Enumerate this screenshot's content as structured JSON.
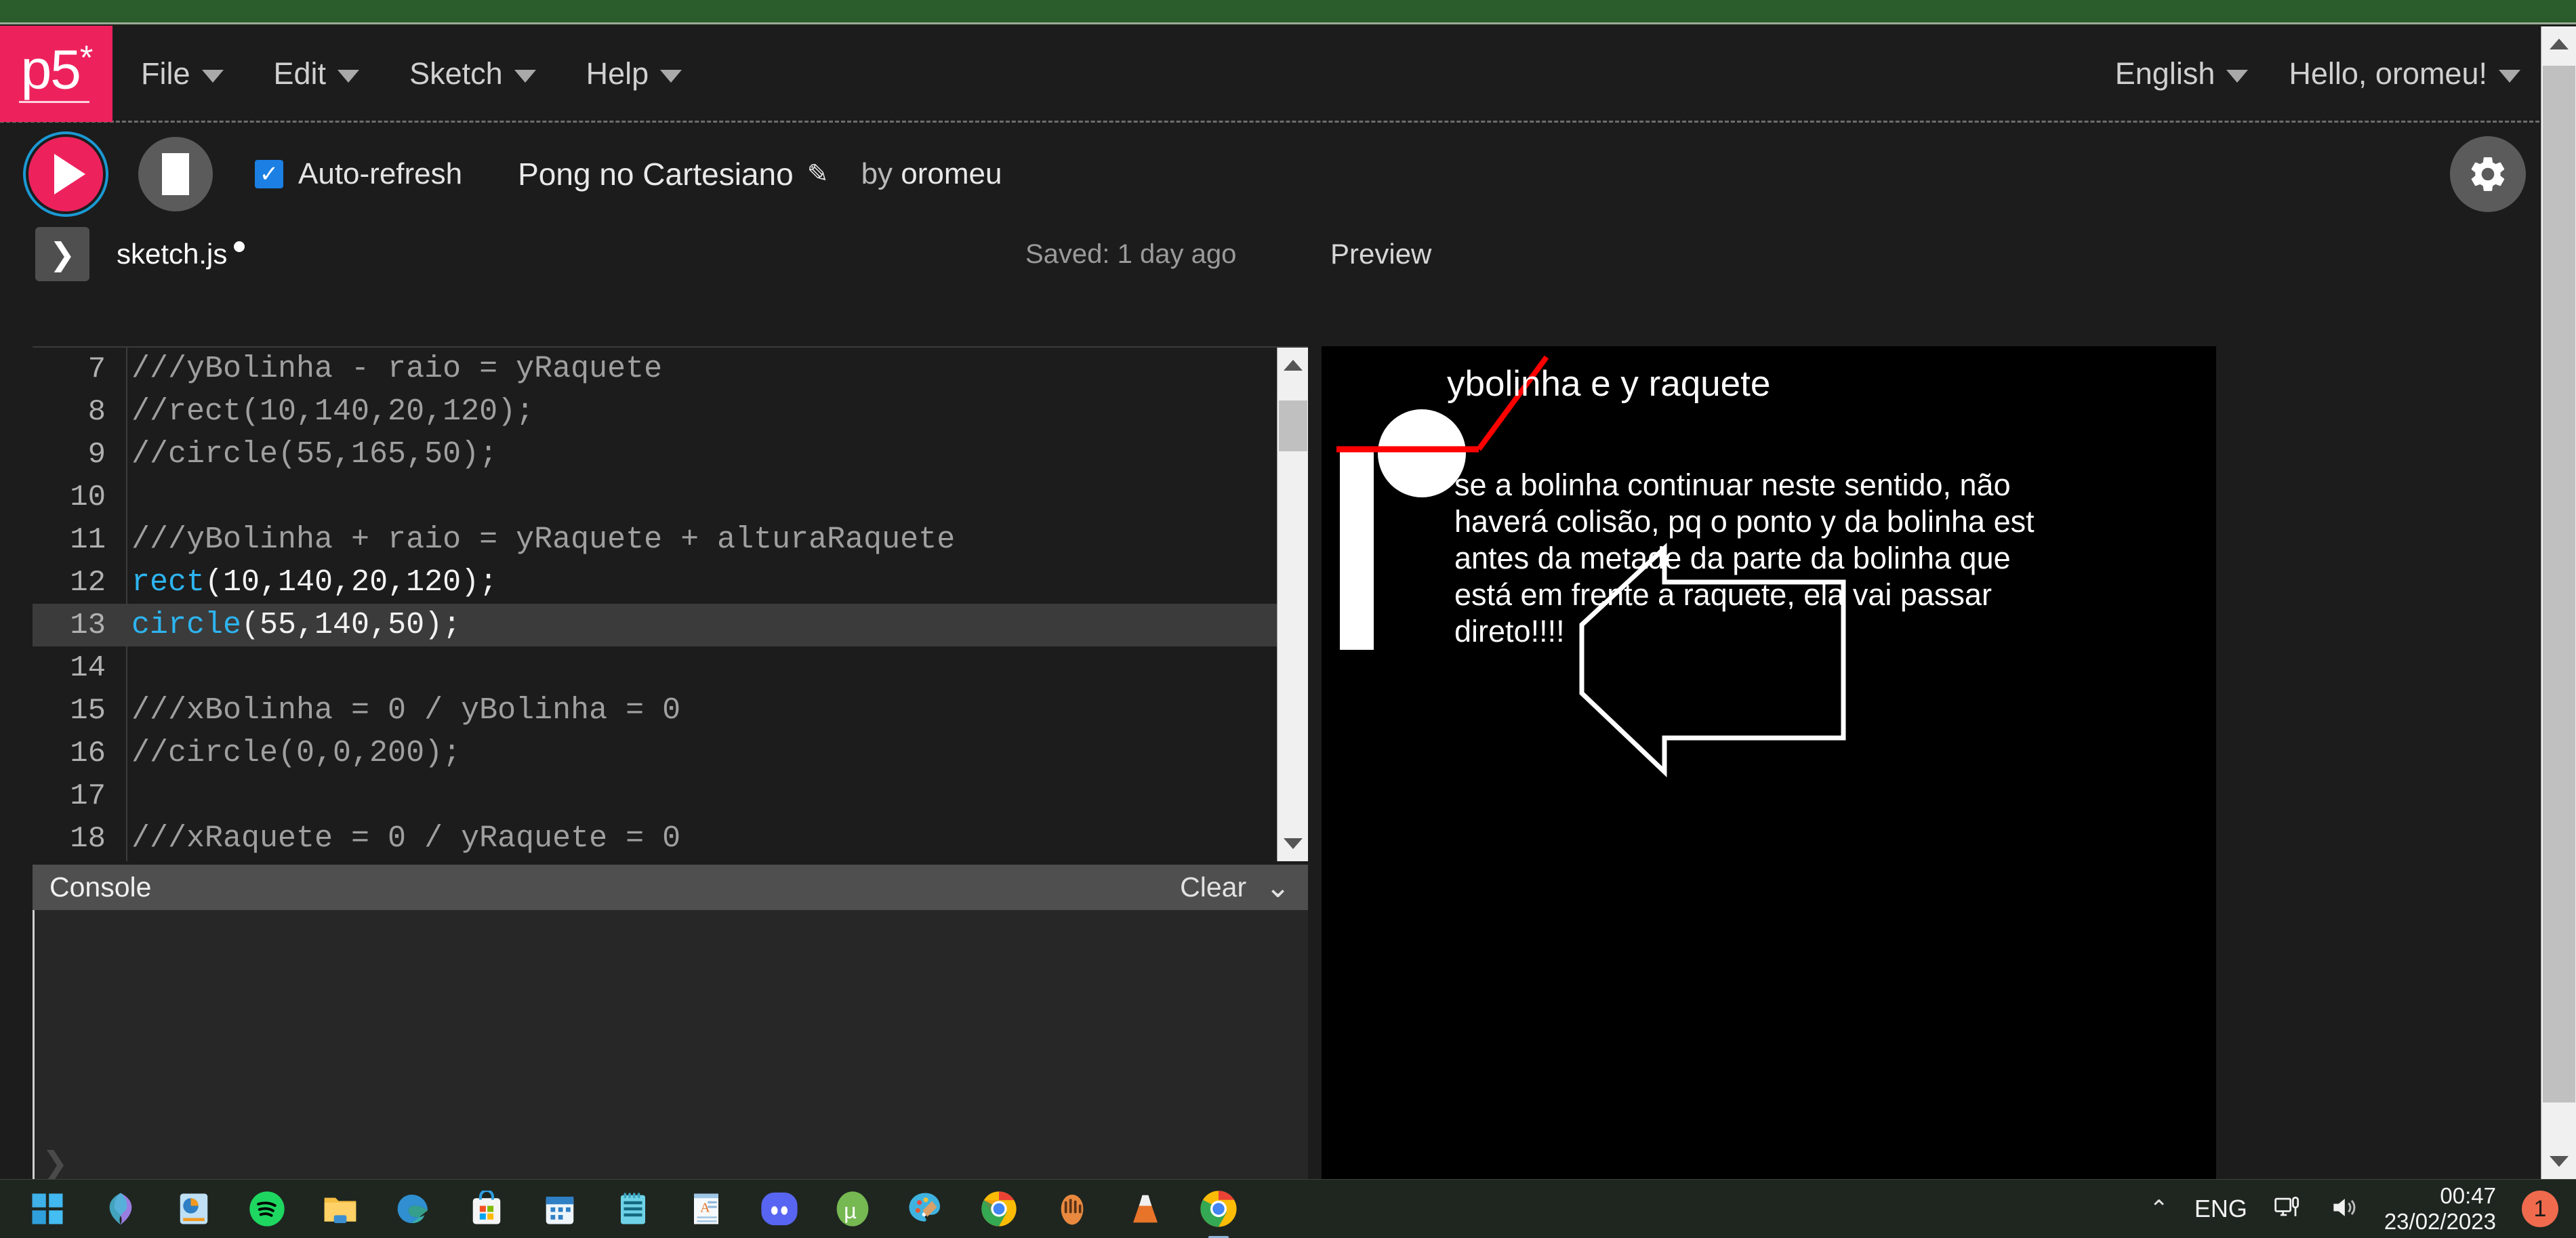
{
  "navbar": {
    "logo_text": "p5",
    "logo_star": "*",
    "menus": [
      {
        "label": "File"
      },
      {
        "label": "Edit"
      },
      {
        "label": "Sketch"
      },
      {
        "label": "Help"
      }
    ],
    "language": "English",
    "greeting": "Hello, oromeu!"
  },
  "toolbar": {
    "play_icon": "play-icon",
    "stop_icon": "stop-icon",
    "autorefresh_label": "Auto-refresh",
    "autorefresh_checked": true,
    "check_glyph": "✓",
    "sketch_name": "Pong no Cartesiano",
    "edit_glyph": "✎",
    "by_prefix": "by ",
    "author": "oromeu",
    "settings_icon": "gear-icon"
  },
  "subbar": {
    "sidebar_toggle_glyph": "❯",
    "filename": "sketch.js",
    "saved_status": "Saved: 1 day ago",
    "preview_label": "Preview"
  },
  "editor": {
    "lines": [
      {
        "num": "7",
        "active": false,
        "tokens": [
          {
            "t": "///yBolinha - raio = yRaquete",
            "c": "cm"
          }
        ]
      },
      {
        "num": "8",
        "active": false,
        "tokens": [
          {
            "t": "//rect(10,140,20,120);",
            "c": "cm"
          }
        ]
      },
      {
        "num": "9",
        "active": false,
        "tokens": [
          {
            "t": "//circle(55,165,50);",
            "c": "cm"
          }
        ]
      },
      {
        "num": "10",
        "active": false,
        "tokens": [
          {
            "t": "",
            "c": "cpl"
          }
        ]
      },
      {
        "num": "11",
        "active": false,
        "tokens": [
          {
            "t": "///yBolinha + raio = yRaquete + alturaRaquete",
            "c": "cm"
          }
        ]
      },
      {
        "num": "12",
        "active": false,
        "tokens": [
          {
            "t": "rect",
            "c": "cfn"
          },
          {
            "t": "(10,140,20,120);",
            "c": "cpl"
          }
        ]
      },
      {
        "num": "13",
        "active": true,
        "tokens": [
          {
            "t": "circle",
            "c": "cfn"
          },
          {
            "t": "(55,140,50);",
            "c": "cpl"
          }
        ]
      },
      {
        "num": "14",
        "active": false,
        "tokens": [
          {
            "t": "",
            "c": "cpl"
          }
        ]
      },
      {
        "num": "15",
        "active": false,
        "tokens": [
          {
            "t": "///xBolinha = 0 / yBolinha = 0",
            "c": "cm"
          }
        ]
      },
      {
        "num": "16",
        "active": false,
        "tokens": [
          {
            "t": "//circle(0,0,200);",
            "c": "cm"
          }
        ]
      },
      {
        "num": "17",
        "active": false,
        "tokens": [
          {
            "t": "",
            "c": "cpl"
          }
        ]
      },
      {
        "num": "18",
        "active": false,
        "tokens": [
          {
            "t": "///xRaquete = 0 / yRaquete = 0",
            "c": "cm"
          }
        ]
      }
    ]
  },
  "console": {
    "title": "Console",
    "clear_label": "Clear",
    "collapse_glyph": "⌄",
    "prompt_glyph": "❯"
  },
  "preview": {
    "title_text": "ybolinha e y raquete",
    "body_text": "se a bolinha continuar neste sentido, não haverá colisão, pq o ponto y da bolinha est antes da metade da parte da bolinha que está em frente a raquete, ela vai passar direto!!!!",
    "background": "#000000",
    "shape_color": "#ffffff",
    "line_color": "#fe0000",
    "shapes": [
      "paddle-rect",
      "ball-circle",
      "red-line",
      "red-diagonal",
      "left-arrow-outline"
    ]
  },
  "taskbar": {
    "icons": [
      {
        "name": "start-icon"
      },
      {
        "name": "copilot-icon"
      },
      {
        "name": "powerpoint-icon"
      },
      {
        "name": "spotify-icon"
      },
      {
        "name": "file-explorer-icon"
      },
      {
        "name": "edge-icon"
      },
      {
        "name": "microsoft-store-icon"
      },
      {
        "name": "calendar-icon"
      },
      {
        "name": "notepad-icon"
      },
      {
        "name": "word-icon"
      },
      {
        "name": "discord-icon"
      },
      {
        "name": "utorrent-icon"
      },
      {
        "name": "paint-icon"
      },
      {
        "name": "chrome-icon"
      },
      {
        "name": "gimp-icon"
      },
      {
        "name": "vlc-icon"
      },
      {
        "name": "chrome-active-icon"
      }
    ],
    "tray": {
      "chevron_glyph": "⌃",
      "language": "ENG",
      "display_icon": "display-icon",
      "volume_icon": "volume-icon",
      "time": "00:47",
      "date": "23/02/2023",
      "notification_count": "1"
    }
  }
}
